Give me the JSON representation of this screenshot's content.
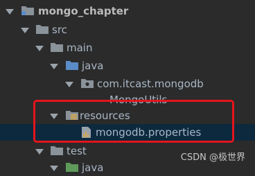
{
  "project_tree": {
    "root": {
      "label": "mongo_chapter"
    },
    "src": {
      "label": "src"
    },
    "main": {
      "label": "main"
    },
    "java": {
      "label": "java"
    },
    "package": {
      "label": "com.itcast.mongodb"
    },
    "class_file": {
      "label": "MongoUtils"
    },
    "resources": {
      "label": "resources"
    },
    "properties_file": {
      "label": "mongodb.properties"
    },
    "test": {
      "label": "test"
    },
    "test_java": {
      "label": "java"
    }
  },
  "watermark": {
    "text": "CSDN @极世界"
  },
  "colors": {
    "background": "#2b2b2b",
    "selection": "#0d293e",
    "highlight_border": "#e5141b",
    "folder": "#8a929a",
    "source_folder": "#5a8cc8",
    "test_folder": "#5e9a5a"
  }
}
